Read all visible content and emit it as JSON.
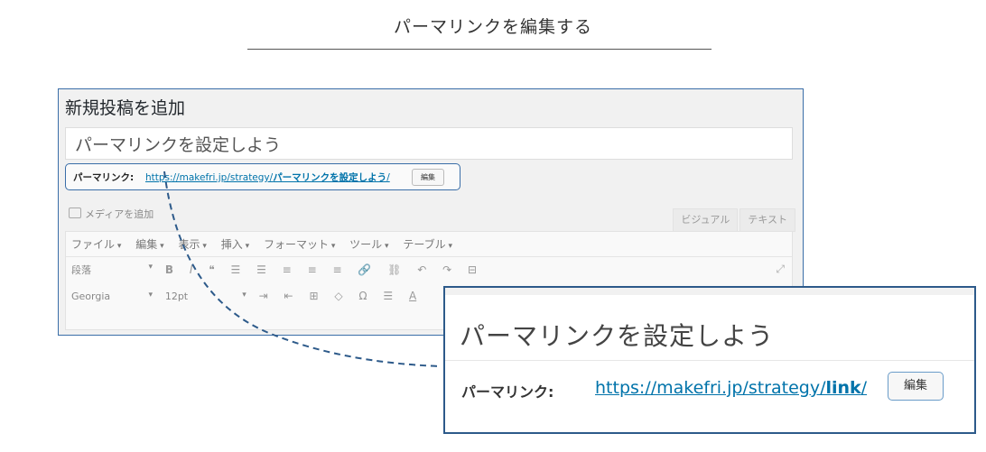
{
  "heading": "パーマリンクを編集する",
  "editor": {
    "page_title": "新規投稿を追加",
    "post_title": "パーマリンクを設定しよう",
    "permalink_label": "パーマリンク:",
    "permalink_base": "https://makefri.jp/strategy/",
    "permalink_slug": "パーマリンクを設定しよう",
    "permalink_trailing": "/",
    "edit_button": "編集",
    "add_media": "メディアを追加",
    "tab_visual": "ビジュアル",
    "tab_text": "テキスト",
    "menus": [
      "ファイル",
      "編集",
      "表示",
      "挿入",
      "フォーマット",
      "ツール",
      "テーブル"
    ],
    "paragraph_select": "段落",
    "font_select": "Georgia",
    "size_select": "12pt",
    "toolbar1": [
      "B",
      "I",
      "❝",
      "☰",
      "☰",
      "≡",
      "≡",
      "≡",
      "🔗",
      "⛓",
      "↶",
      "↷",
      "⊟"
    ],
    "toolbar2": [
      "⇥",
      "⇤",
      "⊞",
      "◇",
      "Ω",
      "☰",
      "A"
    ]
  },
  "zoom": {
    "post_title": "パーマリンクを設定しよう",
    "permalink_label": "パーマリンク:",
    "permalink_base": "https://makefri.jp/strategy/",
    "permalink_slug": "link",
    "permalink_trailing": "/",
    "edit_button": "編集"
  },
  "colors": {
    "accent_border": "#3a6ea8",
    "link": "#0073aa",
    "connector": "#2d5a8a"
  }
}
